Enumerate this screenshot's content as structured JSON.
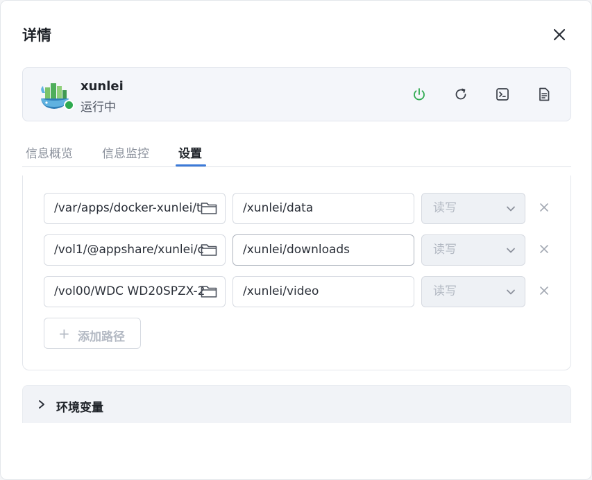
{
  "dialog": {
    "title": "详情"
  },
  "app": {
    "name": "xunlei",
    "status": "运行中",
    "status_color": "#2eaa4f",
    "icon": "whale-app-icon"
  },
  "card_actions": [
    {
      "name": "power-icon",
      "color": "#2eaa4f"
    },
    {
      "name": "refresh-icon",
      "color": "#3a3f48"
    },
    {
      "name": "terminal-icon",
      "color": "#3a3f48"
    },
    {
      "name": "log-document-icon",
      "color": "#3a3f48"
    }
  ],
  "tabs": [
    {
      "label": "信息概览",
      "active": false
    },
    {
      "label": "信息监控",
      "active": false
    },
    {
      "label": "设置",
      "active": true
    }
  ],
  "accent_color": "#3c7ad8",
  "paths": [
    {
      "host": "/var/apps/docker-xunlei/t",
      "container": "/xunlei/data",
      "mode": "读写"
    },
    {
      "host": "/vol1/@appshare/xunlei/c",
      "container": "/xunlei/downloads",
      "mode": "读写"
    },
    {
      "host": "/vol00/WDC WD20SPZX-2",
      "container": "/xunlei/video",
      "mode": "读写"
    }
  ],
  "add_path": {
    "label": "添加路径",
    "icon": "plus-icon"
  },
  "env_section": {
    "label": "环境变量",
    "icon": "chevron-right-icon"
  }
}
